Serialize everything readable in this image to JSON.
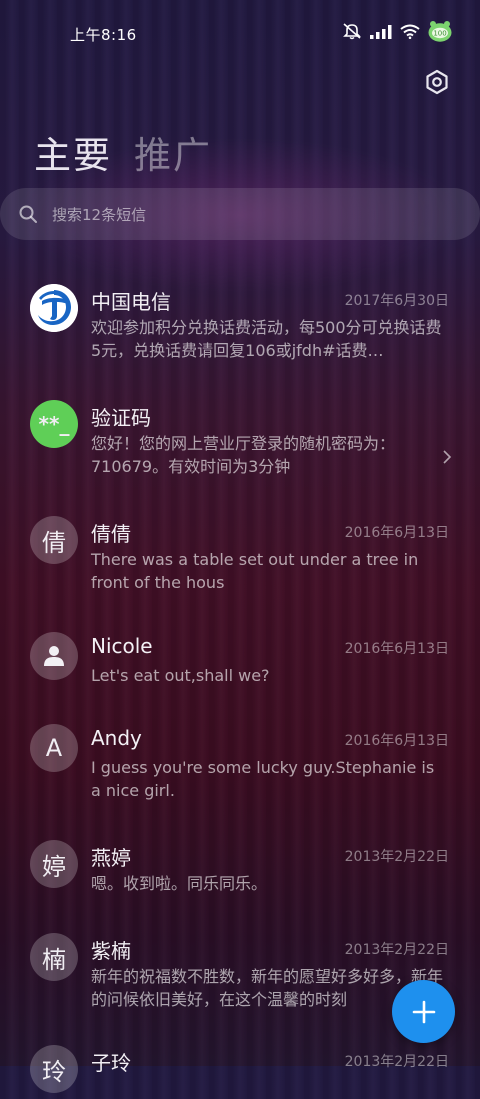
{
  "status_bar": {
    "time": "上午8:16",
    "icons": [
      "mute-icon",
      "signal-icon",
      "wifi-icon",
      "battery-icon"
    ],
    "battery_level": "100"
  },
  "header": {
    "settings_icon": "gear-icon",
    "tabs": [
      {
        "label": "主要",
        "active": true
      },
      {
        "label": "推广",
        "active": false
      }
    ]
  },
  "search": {
    "placeholder": "搜索12条短信"
  },
  "conversations": [
    {
      "name": "中国电信",
      "date": "2017年6月30日",
      "preview": "欢迎参加积分兑换话费活动，每500分可兑换话费5元，兑换话费请回复106或jfdh#话费…",
      "avatar_icon": "china-telecom-logo-icon"
    },
    {
      "name": "验证码",
      "date": "",
      "preview": "您好！您的网上营业厅登录的随机密码为：710679。有效时间为3分钟",
      "avatar_text": "**_",
      "avatar_color": "#5fcf57"
    },
    {
      "name": "倩倩",
      "date": "2016年6月13日",
      "preview": "There was a table set out under a tree in front of the hous",
      "avatar_text": "倩"
    },
    {
      "name": "Nicole",
      "date": "2016年6月13日",
      "preview": "Let's eat out,shall we?",
      "avatar_icon": "person-icon"
    },
    {
      "name": "Andy",
      "date": "2016年6月13日",
      "preview": "I guess you're some lucky guy.Stephanie is a nice girl.",
      "avatar_text": "A"
    },
    {
      "name": "燕婷",
      "date": "2013年2月22日",
      "preview": "嗯。收到啦。同乐同乐。",
      "avatar_text": "婷"
    },
    {
      "name": "紫楠",
      "date": "2013年2月22日",
      "preview": "新年的祝福数不胜数，新年的愿望好多好多，新年的问候依旧美好，在这个温馨的时刻",
      "avatar_text": "楠"
    },
    {
      "name": "子玲",
      "date": "2013年2月22日",
      "preview": "",
      "avatar_text": "玲"
    }
  ],
  "fab": {
    "icon": "plus-icon",
    "color": "#1e90ee"
  }
}
